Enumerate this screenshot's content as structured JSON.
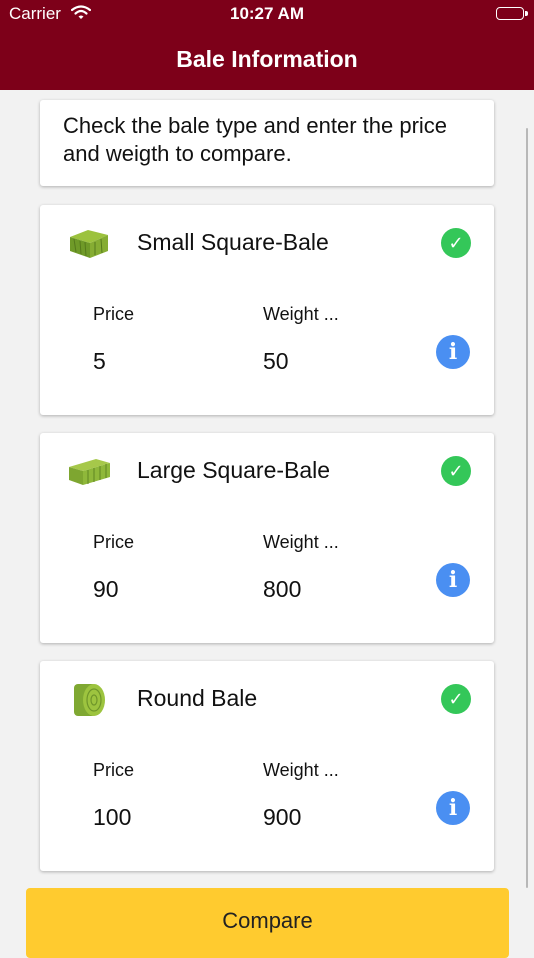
{
  "status_bar": {
    "carrier": "Carrier",
    "time": "10:27 AM"
  },
  "nav": {
    "title": "Bale Information"
  },
  "intro": {
    "text": "Check the bale type and enter the price and weigth to compare."
  },
  "bales": [
    {
      "name": "Small Square-Bale",
      "checked": true,
      "price_label": "Price",
      "price": "5",
      "weight_label": "Weight ...",
      "weight": "50"
    },
    {
      "name": "Large Square-Bale",
      "checked": true,
      "price_label": "Price",
      "price": "90",
      "weight_label": "Weight ...",
      "weight": "800"
    },
    {
      "name": "Round Bale",
      "checked": true,
      "price_label": "Price",
      "price": "100",
      "weight_label": "Weight ...",
      "weight": "900"
    }
  ],
  "compare_button": {
    "label": "Compare"
  },
  "colors": {
    "header": "#7d0019",
    "check": "#34c759",
    "info": "#4a8ff2",
    "compare_button": "#ffcb2f"
  },
  "icons": {
    "wifi": "wifi-icon",
    "battery": "battery-icon",
    "bale_images": [
      "small-square-bale-icon",
      "large-square-bale-icon",
      "round-bale-icon"
    ],
    "check": "checkmark-circle-icon",
    "info": "info-circle-icon"
  }
}
